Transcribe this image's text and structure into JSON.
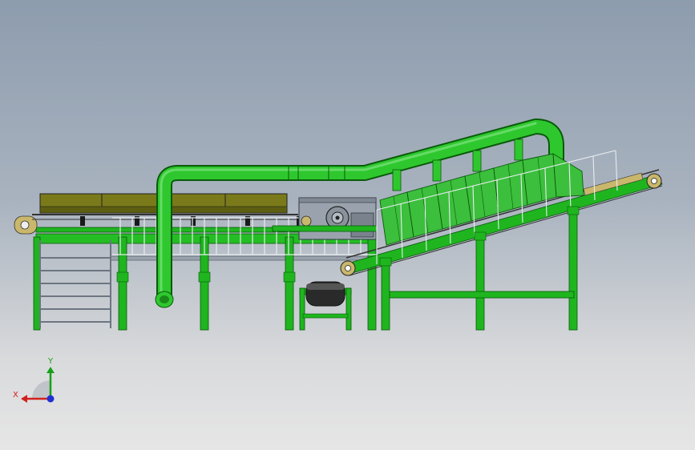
{
  "view": {
    "background_top": "#8d9cae",
    "background_bottom": "#e6e6e6"
  },
  "colors": {
    "frame_green": "#1fb51f",
    "frame_dark": "#0a5a0a",
    "pipe_green": "#2ec82e",
    "box_olive": "#7a7a1a",
    "cover_green": "#3cbf3c",
    "motor_gray": "#9aa3ad",
    "drum_dark": "#2a2a2a"
  },
  "triad": {
    "x_label": "X",
    "y_label": "Y",
    "x_color": "#d22020",
    "y_color": "#18a018",
    "z_color": "#2030d0"
  }
}
